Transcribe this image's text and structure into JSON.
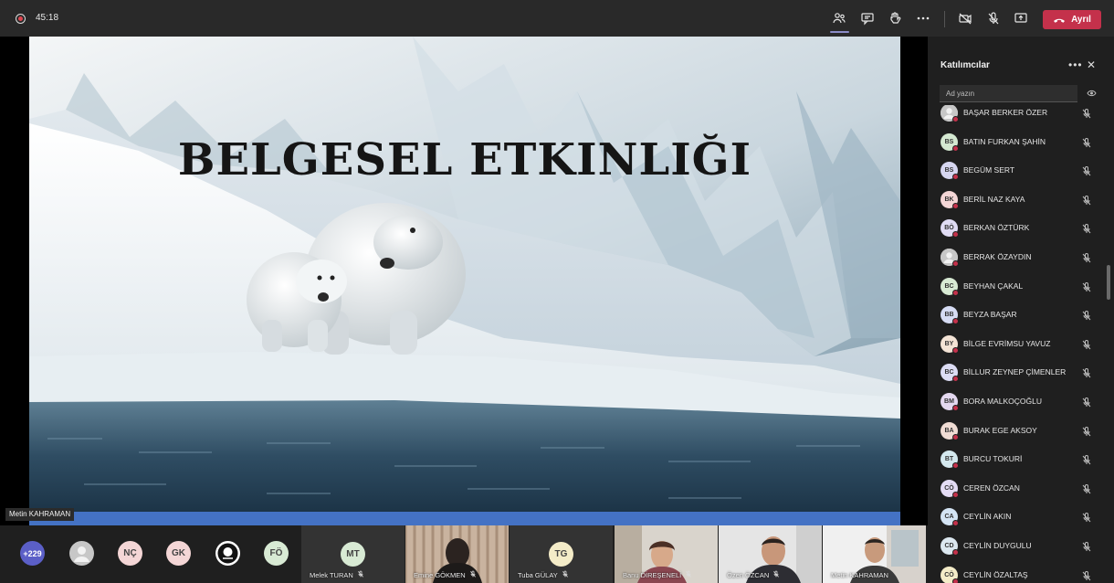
{
  "topbar": {
    "timer": "45:18",
    "leave_label": "Ayrıl",
    "colors": {
      "leave": "#c4314b",
      "accent": "#8b8cc7"
    }
  },
  "slide": {
    "title": "BELGESEL ETKINLIĞI"
  },
  "presenter": {
    "name": "Metin KAHRAMAN"
  },
  "panel": {
    "title": "Katılımcılar",
    "search_placeholder": "Ad yazın",
    "participants": [
      {
        "initials": "",
        "name": "BAŞAR BERKER ÖZER",
        "color": "#c7c7c7"
      },
      {
        "initials": "BS",
        "name": "BATIN FURKAN ŞAHİN",
        "color": "#d4e8d1"
      },
      {
        "initials": "BS",
        "name": "BEGÜM SERT",
        "color": "#d6d6f0"
      },
      {
        "initials": "BK",
        "name": "BERİL NAZ KAYA",
        "color": "#f4d6d6"
      },
      {
        "initials": "BÖ",
        "name": "BERKAN ÖZTÜRK",
        "color": "#e0dcf4"
      },
      {
        "initials": "",
        "name": "BERRAK ÖZAYDIN",
        "color": "#c7c7c7"
      },
      {
        "initials": "BC",
        "name": "BEYHAN ÇAKAL",
        "color": "#d8ead4"
      },
      {
        "initials": "BB",
        "name": "BEYZA BAŞAR",
        "color": "#d6dcf4"
      },
      {
        "initials": "BY",
        "name": "BİLGE EVRİMSU YAVUZ",
        "color": "#f4e4d6"
      },
      {
        "initials": "BC",
        "name": "BİLLUR ZEYNEP ÇİMENLER",
        "color": "#dcdcf4"
      },
      {
        "initials": "BM",
        "name": "BORA MALKOÇOĞLU",
        "color": "#e4d8f0"
      },
      {
        "initials": "BA",
        "name": "BURAK EGE AKSOY",
        "color": "#f0dcd4"
      },
      {
        "initials": "BT",
        "name": "BURCU TOKURİ",
        "color": "#d4e8ee"
      },
      {
        "initials": "CÖ",
        "name": "CEREN ÖZCAN",
        "color": "#e4dcf4"
      },
      {
        "initials": "CA",
        "name": "CEYLİN AKIN",
        "color": "#d4e4f4"
      },
      {
        "initials": "CD",
        "name": "CEYLİN DUYGULU",
        "color": "#dce8f0"
      },
      {
        "initials": "CÖ",
        "name": "CEYLİN ÖZALTAŞ",
        "color": "#f4ecc8"
      }
    ]
  },
  "bottom": {
    "overflow_count": "+229",
    "avatars": [
      {
        "initials": "",
        "color": "#c7c7c7"
      },
      {
        "initials": "NÇ",
        "color": "#f4d6d6"
      },
      {
        "initials": "GK",
        "color": "#f4d6d6"
      },
      {
        "initials": "",
        "color": "#ffffff"
      },
      {
        "initials": "FÖ",
        "color": "#d8ead4"
      }
    ],
    "tiles": [
      {
        "initials": "MT",
        "name": "Melek TURAN",
        "color": "#d8ead4"
      },
      {
        "initials": "",
        "name": "Emine GÖKMEN",
        "color": ""
      },
      {
        "initials": "TG",
        "name": "Tuba GÜLAY",
        "color": "#f4ecc8"
      },
      {
        "initials": "",
        "name": "Banu DİREŞENELİ",
        "color": ""
      },
      {
        "initials": "",
        "name": "Özen ÖZCAN",
        "color": ""
      },
      {
        "initials": "",
        "name": "Metin KAHRAMAN",
        "color": ""
      }
    ]
  }
}
